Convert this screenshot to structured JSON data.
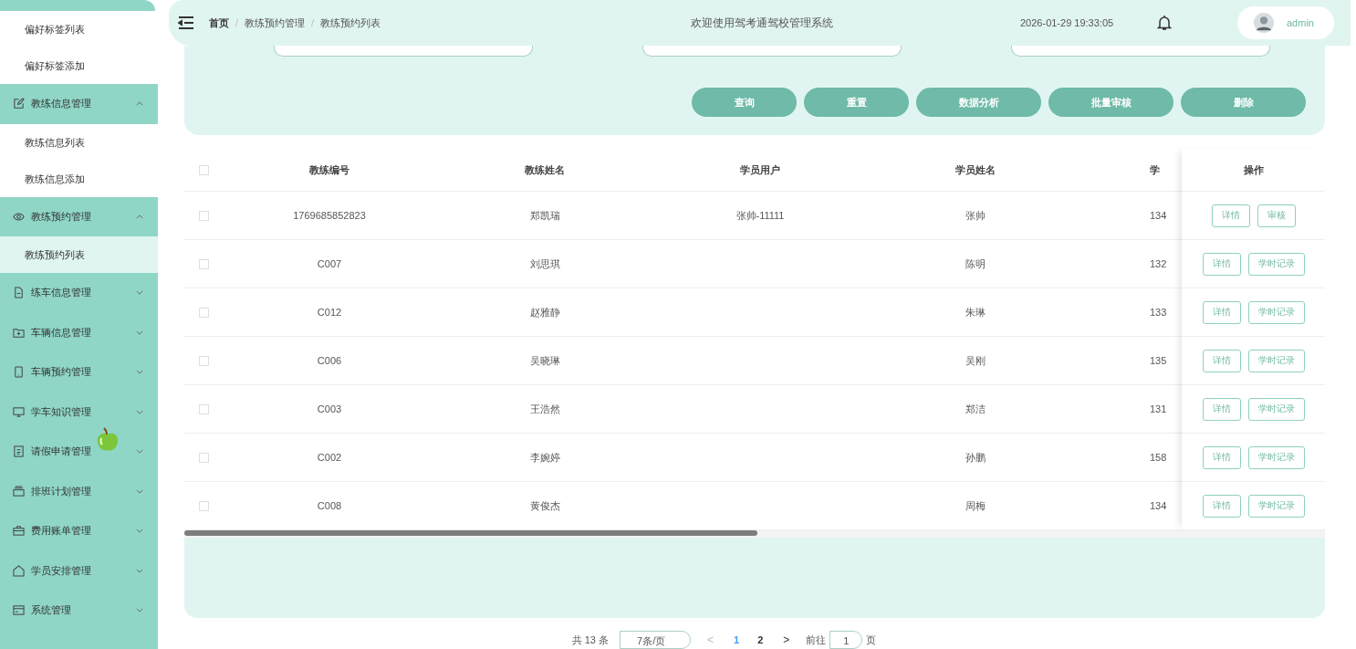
{
  "sidebar": {
    "items": [
      {
        "kind": "sub",
        "label": "偏好标签列表",
        "selected": false
      },
      {
        "kind": "sub",
        "label": "偏好标签添加",
        "selected": false
      },
      {
        "kind": "group",
        "label": "教练信息管理",
        "expanded": true
      },
      {
        "kind": "sub",
        "label": "教练信息列表",
        "selected": false
      },
      {
        "kind": "sub",
        "label": "教练信息添加",
        "selected": false
      },
      {
        "kind": "group",
        "label": "教练预约管理",
        "expanded": true
      },
      {
        "kind": "sub",
        "label": "教练预约列表",
        "selected": true
      },
      {
        "kind": "group",
        "label": "练车信息管理",
        "expanded": false
      },
      {
        "kind": "group",
        "label": "车辆信息管理",
        "expanded": false
      },
      {
        "kind": "group",
        "label": "车辆预约管理",
        "expanded": false
      },
      {
        "kind": "group",
        "label": "学车知识管理",
        "expanded": false
      },
      {
        "kind": "group",
        "label": "请假申请管理",
        "expanded": false
      },
      {
        "kind": "group",
        "label": "排班计划管理",
        "expanded": false
      },
      {
        "kind": "group",
        "label": "费用账单管理",
        "expanded": false
      },
      {
        "kind": "group",
        "label": "学员安排管理",
        "expanded": false
      },
      {
        "kind": "group",
        "label": "系统管理",
        "expanded": false
      }
    ]
  },
  "header": {
    "breadcrumb": [
      "首页",
      "教练预约管理",
      "教练预约列表"
    ],
    "separator": "/",
    "title": "欢迎使用驾考通驾校管理系统",
    "datetime": "2026-01-29 19:33:05",
    "user": "admin"
  },
  "search": {
    "buttons": [
      "查询",
      "重置",
      "数据分析",
      "批量审核",
      "删除"
    ]
  },
  "table": {
    "select_all_checked": false,
    "columns": [
      "教练编号",
      "教练姓名",
      "学员用户",
      "学员姓名",
      "学"
    ],
    "action_column": "操作",
    "rows": [
      {
        "checked": false,
        "cells": [
          "1769685852823",
          "郑凯瑞",
          "张帅-11111",
          "张帅",
          "134"
        ],
        "actions": [
          "详情",
          "审核"
        ]
      },
      {
        "checked": false,
        "cells": [
          "C007",
          "刘思琪",
          "",
          "陈明",
          "132"
        ],
        "actions": [
          "详情",
          "学时记录"
        ]
      },
      {
        "checked": false,
        "cells": [
          "C012",
          "赵雅静",
          "",
          "朱琳",
          "133"
        ],
        "actions": [
          "详情",
          "学时记录"
        ]
      },
      {
        "checked": false,
        "cells": [
          "C006",
          "吴晓琳",
          "",
          "吴刚",
          "135"
        ],
        "actions": [
          "详情",
          "学时记录"
        ]
      },
      {
        "checked": false,
        "cells": [
          "C003",
          "王浩然",
          "",
          "郑洁",
          "131"
        ],
        "actions": [
          "详情",
          "学时记录"
        ]
      },
      {
        "checked": false,
        "cells": [
          "C002",
          "李婉婷",
          "",
          "孙鹏",
          "158"
        ],
        "actions": [
          "详情",
          "学时记录"
        ]
      },
      {
        "checked": false,
        "cells": [
          "C008",
          "黄俊杰",
          "",
          "周梅",
          "134"
        ],
        "actions": [
          "详情",
          "学时记录"
        ]
      }
    ]
  },
  "pagination": {
    "total": "共 13 条",
    "page_size": "7条/页",
    "prev": "<",
    "pages": [
      {
        "label": "1",
        "selected": true
      },
      {
        "label": "2",
        "selected": false
      }
    ],
    "next": ">",
    "goto_label": "前往",
    "goto_value": "1",
    "goto_suffix": "页"
  }
}
